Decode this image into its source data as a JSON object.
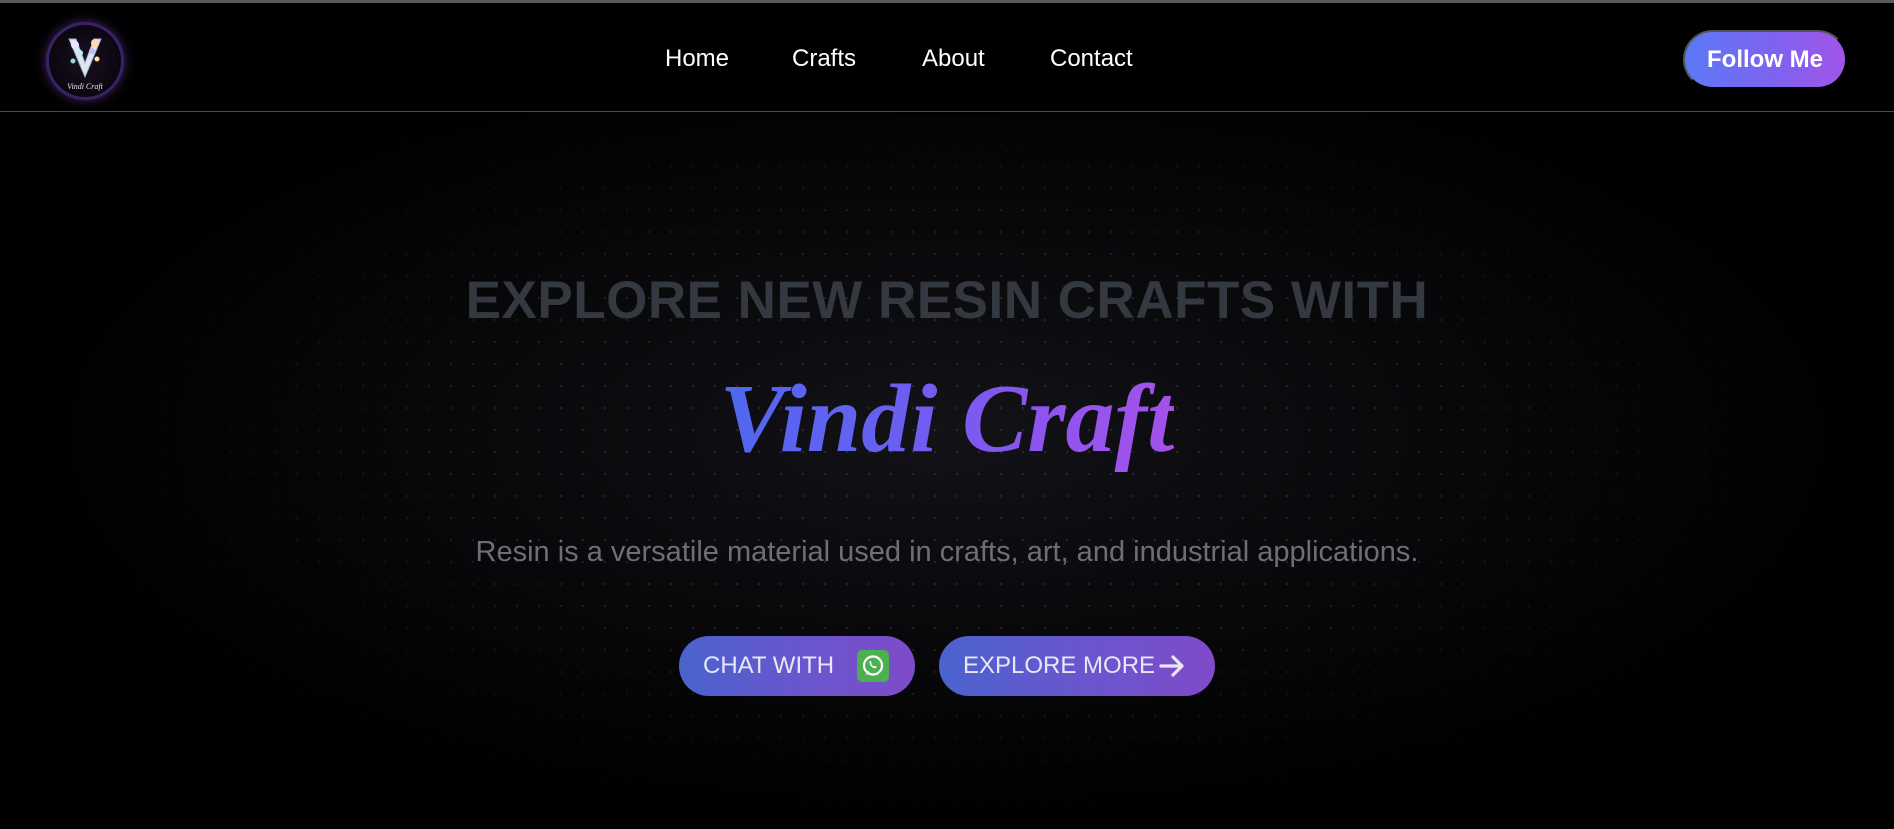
{
  "nav": {
    "logo_alt": "Vindi Craft",
    "links": [
      "Home",
      "Crafts",
      "About",
      "Contact"
    ],
    "follow_label": "Follow Me"
  },
  "hero": {
    "heading": "EXPLORE NEW RESIN CRAFTS WITH",
    "brand": "Vindi Craft",
    "subtitle": "Resin is a versatile material used in crafts, art, and industrial applications.",
    "chat_label": "CHAT WITH",
    "explore_label": "EXPLORE MORE"
  },
  "icons": {
    "logo": "vindi-craft-logo",
    "chat": "whatsapp-icon",
    "explore": "arrow-right-icon"
  },
  "colors": {
    "background": "#000000",
    "accent_start": "#5b79f5",
    "accent_end": "#a155e8",
    "whatsapp_green": "#4caf50",
    "heading_gray": "#343840",
    "subtitle_gray": "#6d6f78"
  }
}
